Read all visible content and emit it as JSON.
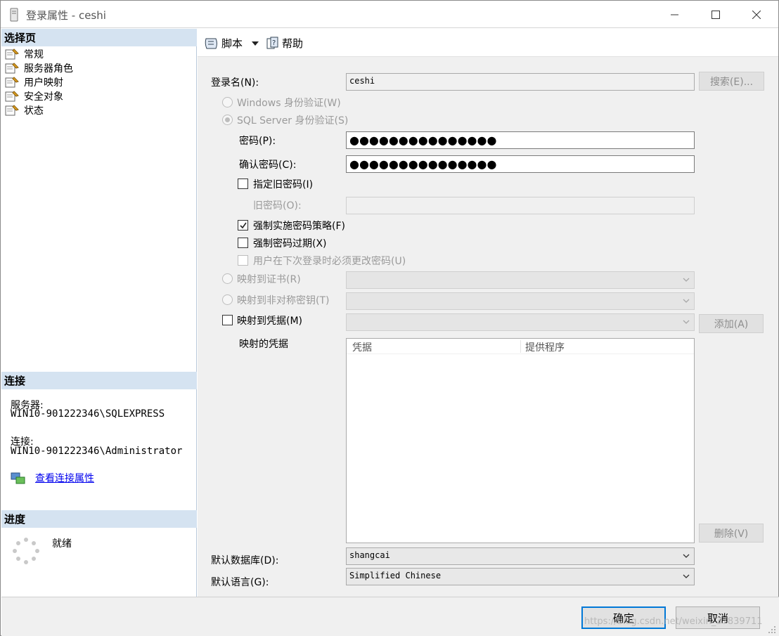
{
  "window": {
    "title": "登录属性 - ceshi"
  },
  "left": {
    "select_page_header": "选择页",
    "pages": [
      {
        "label": "常规"
      },
      {
        "label": "服务器角色"
      },
      {
        "label": "用户映射"
      },
      {
        "label": "安全对象"
      },
      {
        "label": "状态"
      }
    ],
    "connection_header": "连接",
    "server_label": "服务器:",
    "server_value": "WIN10-901222346\\SQLEXPRESS",
    "connection_label": "连接:",
    "connection_value": "WIN10-901222346\\Administrator",
    "view_props_link": "查看连接属性",
    "progress_header": "进度",
    "progress_status": "就绪"
  },
  "toolbar": {
    "script_label": "脚本",
    "help_label": "帮助"
  },
  "form": {
    "login_name_label": "登录名(N):",
    "login_name_value": "ceshi",
    "search_button": "搜索(E)...",
    "windows_auth_label": "Windows 身份验证(W)",
    "sql_auth_label": "SQL Server 身份验证(S)",
    "password_label": "密码(P):",
    "password_value": "●●●●●●●●●●●●●●●",
    "confirm_password_label": "确认密码(C):",
    "confirm_password_value": "●●●●●●●●●●●●●●●",
    "specify_old_password_label": "指定旧密码(I)",
    "old_password_label": "旧密码(O):",
    "enforce_policy_label": "强制实施密码策略(F)",
    "enforce_expiration_label": "强制密码过期(X)",
    "must_change_label": "用户在下次登录时必须更改密码(U)",
    "map_certificate_label": "映射到证书(R)",
    "map_asym_key_label": "映射到非对称密钥(T)",
    "map_credential_label": "映射到凭据(M)",
    "add_button": "添加(A)",
    "mapped_credentials_label": "映射的凭据",
    "grid_columns": [
      "凭据",
      "提供程序"
    ],
    "remove_button": "删除(V)",
    "default_db_label": "默认数据库(D):",
    "default_db_value": "shangcai",
    "default_lang_label": "默认语言(G):",
    "default_lang_value": "Simplified Chinese"
  },
  "footer": {
    "ok_button": "确定",
    "cancel_button": "取消",
    "watermark": "https://blog.csdn.net/weixin_37839711"
  },
  "colors": {
    "section_header": "#d5e3f1",
    "link": "#0000ee",
    "focus_border": "#0078d7"
  }
}
